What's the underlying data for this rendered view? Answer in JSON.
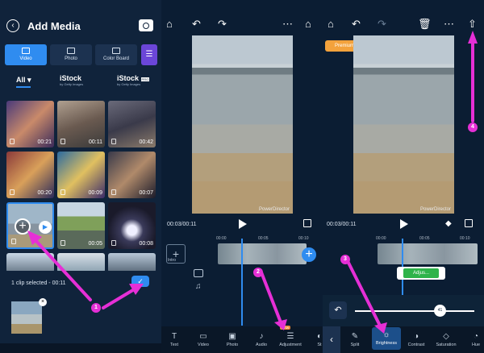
{
  "add_media": {
    "title": "Add Media",
    "tabs": [
      {
        "label": "Video",
        "active": true
      },
      {
        "label": "Photo",
        "active": false
      },
      {
        "label": "Color Board",
        "active": false
      }
    ],
    "filters": {
      "all": "All",
      "istock": "iStock",
      "istock_sub": "by Getty Images",
      "istock_pro": "iStock",
      "pro_badge": "PRO"
    },
    "thumbnails": [
      {
        "duration": "00:21",
        "color": "#7b5a8a"
      },
      {
        "duration": "00:11",
        "color": "#8a7b70"
      },
      {
        "duration": "00:42",
        "color": "#5b5d6b"
      },
      {
        "duration": "00:20",
        "color": "#6a4a4a"
      },
      {
        "duration": "00:09",
        "color": "#3f6b8f"
      },
      {
        "duration": "00:07",
        "color": "#4b4a5c"
      },
      {
        "duration": "",
        "color": "#8aa7c0"
      },
      {
        "duration": "00:05",
        "color": "#8ea26a"
      },
      {
        "duration": "00:08",
        "color": "#2a2d3a"
      }
    ],
    "selected_text": "1 clip selected - 00:11",
    "check": "✓",
    "close": "×"
  },
  "editor_a": {
    "time": "00:03/00:11",
    "ruler": [
      "00:00",
      "00:05",
      "00:10"
    ],
    "intro": "Intro",
    "watermark": "PowerDirector",
    "tools": [
      {
        "label": "Text",
        "glyph": "T"
      },
      {
        "label": "Video",
        "glyph": "▭"
      },
      {
        "label": "Photo",
        "glyph": "▣"
      },
      {
        "label": "Audio",
        "glyph": "♪"
      },
      {
        "label": "Adjustment",
        "glyph": "☰"
      },
      {
        "label": "St",
        "glyph": "◐"
      }
    ],
    "new_badge": "NEW"
  },
  "editor_b": {
    "premium": "Premium features used",
    "time": "00:03/00:11",
    "ruler": [
      "00:00",
      "00:05",
      "00:10"
    ],
    "watermark": "PowerDirector",
    "adjust_label": "Adjus...",
    "slider_value": "41",
    "tools": [
      {
        "label": "Split",
        "glyph": "✎"
      },
      {
        "label": "Brightness",
        "glyph": "☼",
        "active": true
      },
      {
        "label": "Contrast",
        "glyph": "◑"
      },
      {
        "label": "Saturation",
        "glyph": "◇"
      },
      {
        "label": "Hue",
        "glyph": "◔"
      }
    ]
  },
  "annotations": [
    "1",
    "2",
    "3",
    "4"
  ],
  "colors": {
    "accent": "#2f8cf0",
    "annotation": "#e62fd6",
    "background": "#0b1d33"
  }
}
